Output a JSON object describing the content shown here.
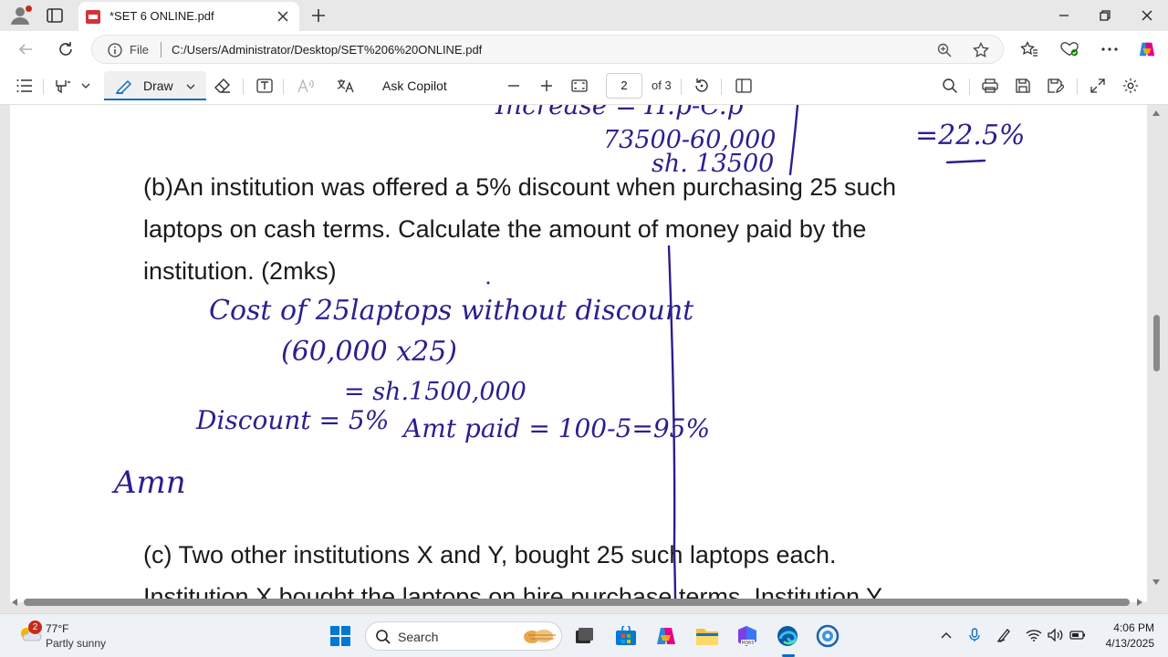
{
  "browser": {
    "tab_title": "*SET 6 ONLINE.pdf",
    "address_scheme_label": "File",
    "url": "C:/Users/Administrator/Desktop/SET%206%20ONLINE.pdf"
  },
  "pdf_toolbar": {
    "draw_label": "Draw",
    "ask_copilot_label": "Ask Copilot",
    "current_page": "2",
    "page_of_label": "of 3"
  },
  "document": {
    "lines": [
      "(b)An institution was offered a 5% discount when purchasing 25 such",
      "laptops on cash terms. Calculate the amount of money paid by the",
      "institution.   (2mks)",
      "(c) Two other institutions X and Y, bought 25 such laptops each.",
      "Institution X bought the laptops on hire purchase terms. Institution Y"
    ],
    "handwriting": {
      "top_left": "Increase = H.p-C.p",
      "top_calc": "73500-60,000",
      "top_result": "sh. 13500",
      "top_right": "=22.5%",
      "cost_line": "Cost of 25laptops without discount",
      "multiply_line": "(60,000 x25)",
      "total_line": "= sh.1500,000",
      "discount_line": "Discount = 5%",
      "amount_paid_line": "Amt paid = 100-5=95%",
      "amount_start": "Amn"
    }
  },
  "taskbar": {
    "weather_badge": "2",
    "weather_temp": "77°F",
    "weather_desc": "Partly sunny",
    "search_label": "Search",
    "time": "4:06 PM",
    "date": "4/13/2025"
  },
  "colors": {
    "ink": "#2a1f8f",
    "accent": "#0f6cbd",
    "page_bg": "#ffffff"
  }
}
